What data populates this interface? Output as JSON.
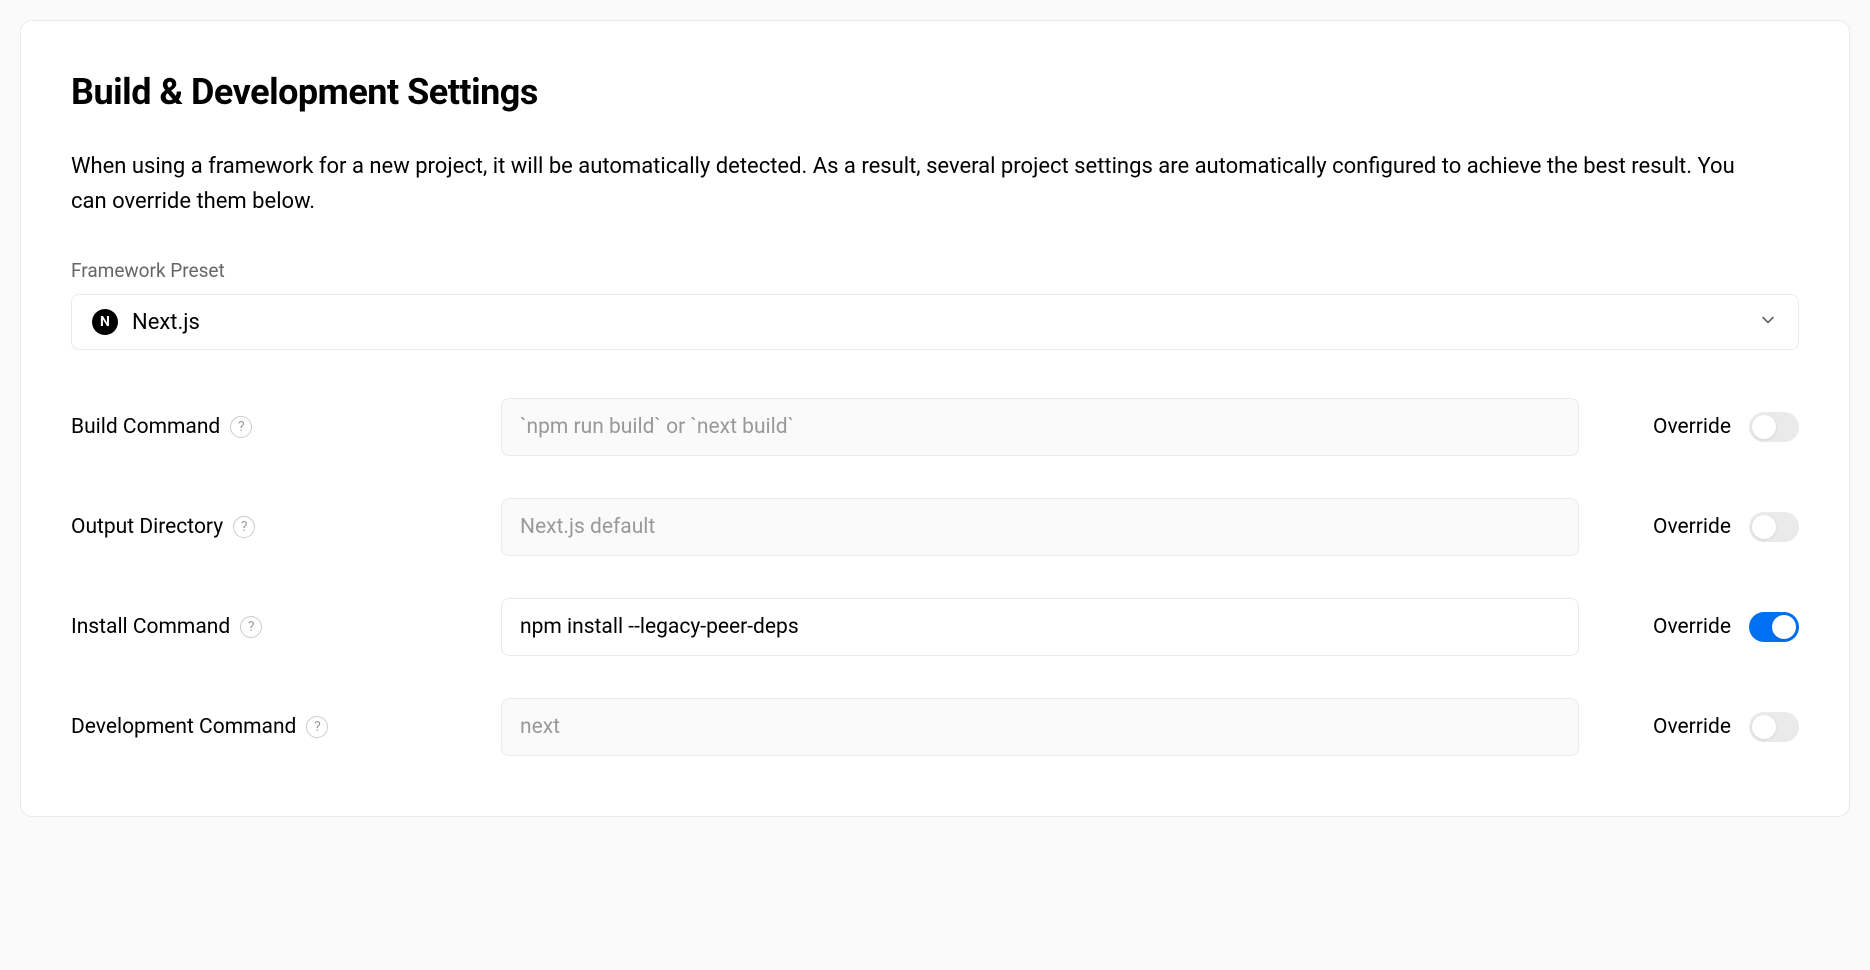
{
  "header": {
    "title": "Build & Development Settings",
    "description": "When using a framework for a new project, it will be automatically detected. As a result, several project settings are automatically configured to achieve the best result. You can override them below."
  },
  "preset": {
    "label": "Framework Preset",
    "value": "Next.js"
  },
  "settings": [
    {
      "label": "Build Command",
      "placeholder": "`npm run build` or `next build`",
      "value": "",
      "override_label": "Override",
      "override_on": false
    },
    {
      "label": "Output Directory",
      "placeholder": "Next.js default",
      "value": "",
      "override_label": "Override",
      "override_on": false
    },
    {
      "label": "Install Command",
      "placeholder": "",
      "value": "npm install --legacy-peer-deps",
      "override_label": "Override",
      "override_on": true
    },
    {
      "label": "Development Command",
      "placeholder": "next",
      "value": "",
      "override_label": "Override",
      "override_on": false
    }
  ]
}
